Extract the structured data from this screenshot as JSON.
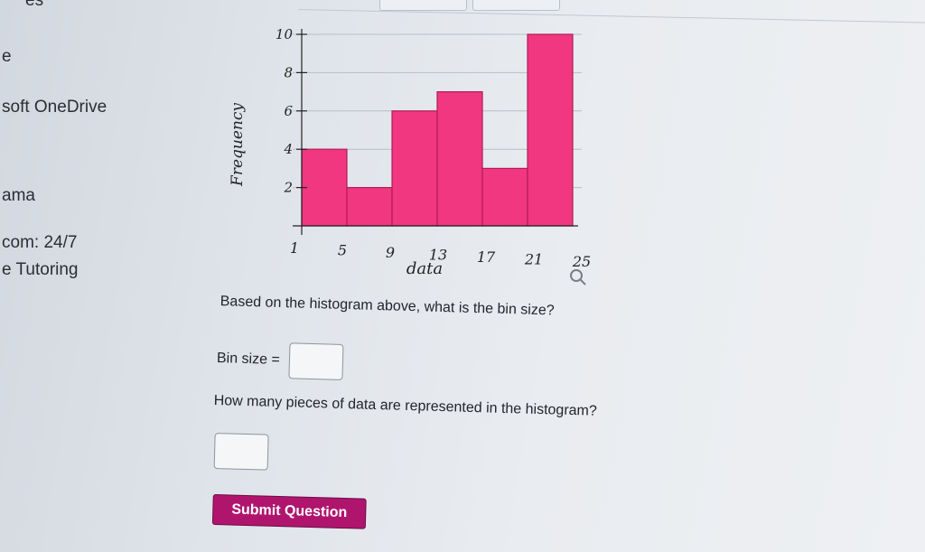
{
  "sidebar": {
    "items": [
      "es",
      "e",
      "soft OneDrive",
      "ama",
      "com: 24/7",
      "e Tutoring"
    ]
  },
  "chart_data": {
    "type": "bar",
    "title": "",
    "xlabel": "data",
    "ylabel": "Frequency",
    "bin_edges": [
      1,
      5,
      9,
      13,
      17,
      21,
      25
    ],
    "values": [
      4,
      2,
      6,
      7,
      3,
      10
    ],
    "y_ticks": [
      2,
      4,
      6,
      8,
      10
    ],
    "ylim": [
      0,
      10
    ],
    "grid": true,
    "bar_color": "#f0377f"
  },
  "question1": {
    "text": "Based on the histogram above, what is the bin size?"
  },
  "bin_size": {
    "label": "Bin size =",
    "value": ""
  },
  "question2": {
    "text": "How many pieces of data are represented in the histogram?"
  },
  "answer2": {
    "value": ""
  },
  "submit": {
    "label": "Submit Question"
  },
  "colors": {
    "submit_bg": "#b0156e",
    "bar": "#f0377f",
    "bar_edge": "#b4195c"
  }
}
